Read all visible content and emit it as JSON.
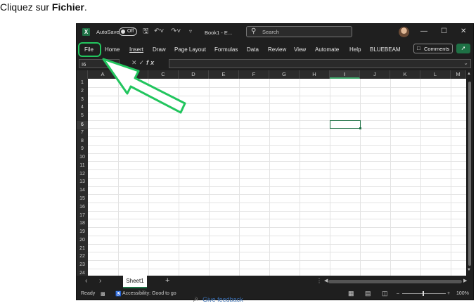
{
  "instruction": {
    "prefix": "Cliquez sur ",
    "bold": "Fichier",
    "suffix": "."
  },
  "titlebar": {
    "logo": "X",
    "autosave_label": "AutoSave",
    "autosave_state": "Off",
    "book_title": "Book1 - E...",
    "search_placeholder": "Search",
    "icons": [
      "save-icon",
      "undo-icon",
      "redo-icon",
      "customize-icon"
    ],
    "window_controls": [
      "minimize",
      "maximize",
      "close"
    ]
  },
  "ribbon": {
    "tabs": [
      "File",
      "Home",
      "Insert",
      "Draw",
      "Page Layout",
      "Formulas",
      "Data",
      "Review",
      "View",
      "Automate",
      "Help",
      "BLUEBEAM"
    ],
    "comments_label": "Comments"
  },
  "formula_bar": {
    "name_box": "I6",
    "formula": ""
  },
  "columns": [
    "A",
    "B",
    "C",
    "D",
    "E",
    "F",
    "G",
    "H",
    "I",
    "J",
    "K",
    "L",
    "M"
  ],
  "selected_column": "I",
  "rows": [
    "1",
    "2",
    "3",
    "4",
    "5",
    "6",
    "7",
    "8",
    "9",
    "10",
    "11",
    "12",
    "13",
    "14",
    "15",
    "16",
    "17",
    "18",
    "19",
    "20",
    "21",
    "22",
    "23",
    "24"
  ],
  "selected_row": "6",
  "sheet_tabs": [
    "Sheet1"
  ],
  "status": {
    "ready": "Ready",
    "accessibility": "Accessibility: Good to go",
    "zoom": "100%"
  },
  "feedback": "Give feedback",
  "colors": {
    "highlight": "#22c55e",
    "excel_green": "#1e7145",
    "dark_bg": "#1f1f1f"
  }
}
